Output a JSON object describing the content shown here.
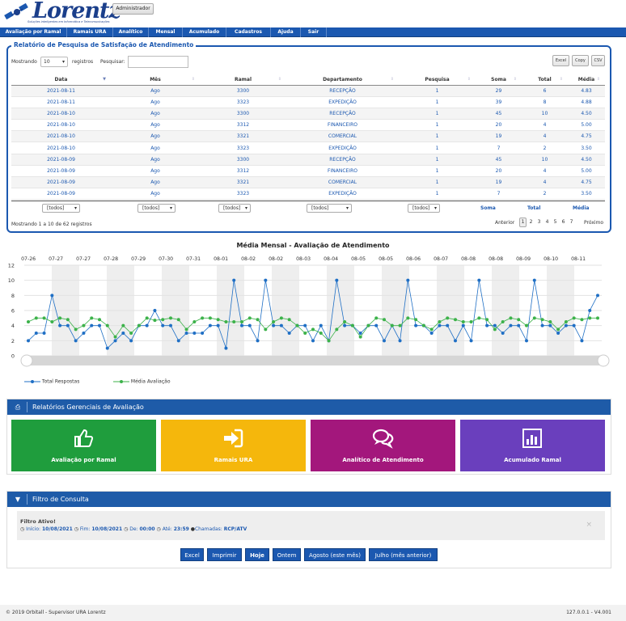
{
  "header": {
    "brand": "Lorentz",
    "tagline": "Soluções inteligentes em Informática e Telecomunicações",
    "admin_label": "Administrador"
  },
  "nav": [
    "Avaliação por Ramal",
    "Ramais URA",
    "Analítico",
    "Mensal",
    "Acumulado",
    "Cadastros",
    "Ajuda",
    "Sair"
  ],
  "report": {
    "title": "Relatório de Pesquisa de Satisfação de Atendimento",
    "show_label": "Mostrando",
    "page_size": "10",
    "records_label": "registros",
    "search_label": "Pesquisar:",
    "search_value": "",
    "export": [
      "Excel",
      "Copy",
      "CSV"
    ],
    "columns": [
      "Data",
      "Mês",
      "Ramal",
      "Departamento",
      "Pesquisa",
      "Soma",
      "Total",
      "Média"
    ],
    "rows": [
      [
        "2021-08-11",
        "Ago",
        "3300",
        "RECEPÇÃO",
        "1",
        "29",
        "6",
        "4.83"
      ],
      [
        "2021-08-11",
        "Ago",
        "3323",
        "EXPEDIÇÃO",
        "1",
        "39",
        "8",
        "4.88"
      ],
      [
        "2021-08-10",
        "Ago",
        "3300",
        "RECEPÇÃO",
        "1",
        "45",
        "10",
        "4.50"
      ],
      [
        "2021-08-10",
        "Ago",
        "3312",
        "FINANCEIRO",
        "1",
        "20",
        "4",
        "5.00"
      ],
      [
        "2021-08-10",
        "Ago",
        "3321",
        "COMERCIAL",
        "1",
        "19",
        "4",
        "4.75"
      ],
      [
        "2021-08-10",
        "Ago",
        "3323",
        "EXPEDIÇÃO",
        "1",
        "7",
        "2",
        "3.50"
      ],
      [
        "2021-08-09",
        "Ago",
        "3300",
        "RECEPÇÃO",
        "1",
        "45",
        "10",
        "4.50"
      ],
      [
        "2021-08-09",
        "Ago",
        "3312",
        "FINANCEIRO",
        "1",
        "20",
        "4",
        "5.00"
      ],
      [
        "2021-08-09",
        "Ago",
        "3321",
        "COMERCIAL",
        "1",
        "19",
        "4",
        "4.75"
      ],
      [
        "2021-08-09",
        "Ago",
        "3323",
        "EXPEDIÇÃO",
        "1",
        "7",
        "2",
        "3.50"
      ]
    ],
    "filter_all": "[todos]",
    "foot_soma": "Soma",
    "foot_total": "Total",
    "foot_media": "Média",
    "info": "Mostrando 1 a 10 de 62 registros",
    "prev": "Anterior",
    "pages": [
      "1",
      "2",
      "3",
      "4",
      "5",
      "6",
      "7"
    ],
    "next": "Próximo"
  },
  "chart_data": {
    "type": "line",
    "title": "Média Mensal - Avaliação de Atendimento",
    "categories": [
      "07-26",
      "07-27",
      "07-27",
      "07-28",
      "07-29",
      "07-30",
      "07-31",
      "08-01",
      "08-02",
      "08-02",
      "08-03",
      "08-04",
      "08-05",
      "08-05",
      "08-06",
      "08-07",
      "08-08",
      "08-08",
      "08-09",
      "08-10",
      "08-11"
    ],
    "ylim": [
      0,
      12
    ],
    "yticks": [
      0,
      2,
      4,
      6,
      8,
      10,
      12
    ],
    "series": [
      {
        "name": "Total Respostas",
        "color": "#1f6fc5",
        "values": [
          2,
          3,
          3,
          8,
          4,
          4,
          2,
          3,
          4,
          4,
          1,
          2,
          3,
          2,
          4,
          4,
          6,
          4,
          4,
          2,
          3,
          3,
          3,
          4,
          4,
          1,
          10,
          4,
          4,
          2,
          10,
          4,
          4,
          3,
          4,
          4,
          2,
          4,
          2,
          10,
          4,
          4,
          3,
          4,
          4,
          2,
          4,
          2,
          10,
          4,
          4,
          3,
          4,
          4,
          2,
          4,
          2,
          10,
          4,
          4,
          3,
          4,
          4,
          2,
          10,
          4,
          4,
          3,
          4,
          4,
          2,
          6,
          8
        ]
      },
      {
        "name": "Média Avaliação",
        "color": "#3cb24a",
        "values": [
          4.5,
          5,
          5,
          4.5,
          5,
          4.8,
          3.5,
          4,
          5,
          4.8,
          4,
          2.5,
          4,
          3,
          4,
          5,
          4.7,
          4.8,
          5,
          4.8,
          3.5,
          4.5,
          5,
          5,
          4.8,
          4.5,
          4.5,
          4.5,
          5,
          4.8,
          3.5,
          4.5,
          5,
          4.8,
          4,
          3,
          3.5,
          3,
          2,
          3.5,
          4.5,
          4,
          2.5,
          4,
          5,
          4.8,
          4,
          4,
          5,
          4.8,
          4,
          3.5,
          4.5,
          5,
          4.8,
          4.5,
          4.5,
          5,
          4.8,
          3.5,
          4.5,
          5,
          4.8,
          4,
          5,
          4.8,
          4.5,
          3.5,
          4.5,
          5,
          4.8,
          5,
          5
        ]
      }
    ]
  },
  "gerenciais": {
    "title": "Relatórios Gerenciais de Avaliação",
    "tiles": [
      {
        "label": "Avaliação por Ramal",
        "color": "#1f9d3d"
      },
      {
        "label": "Ramais URA",
        "color": "#f5b70c"
      },
      {
        "label": "Analítico de Atendimento",
        "color": "#a3177c"
      },
      {
        "label": "Acumulado Ramal",
        "color": "#6a3fbd"
      }
    ]
  },
  "filtro": {
    "title": "Filtro de Consulta",
    "active_label": "Filtro Ativo!",
    "inicio_label": "Início:",
    "inicio": "10/08/2021",
    "fim_label": "Fim:",
    "fim": "10/08/2021",
    "de_label": "De:",
    "de": "00:00",
    "ate_label": "Até:",
    "ate": "23:59",
    "chamadas_label": "Chamadas:",
    "chamadas": "RCP/ATV",
    "buttons": [
      "Excel",
      "Imprimir",
      "Hoje",
      "Ontem",
      "Agosto (este mês)",
      "Julho (mês anterior)"
    ]
  },
  "footer": {
    "copyright": "© 2019 Orbitall - Supervisor URA Lorentz",
    "version": "127.0.0.1 - V4.001"
  }
}
